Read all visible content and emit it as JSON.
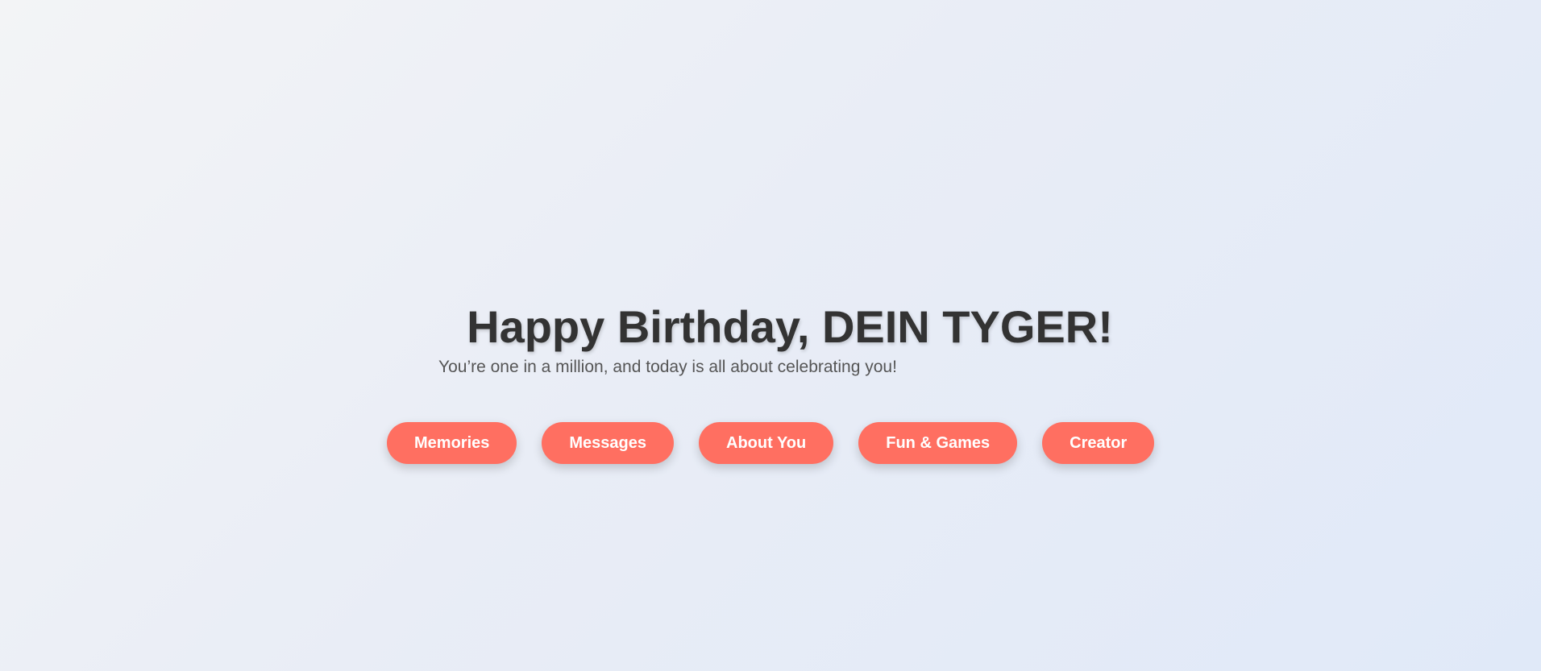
{
  "hero": {
    "title": "Happy Birthday, DEIN TYGER!",
    "subtitle": "You’re one in a million, and today is all about celebrating you!"
  },
  "nav": {
    "items": [
      {
        "label": "Memories"
      },
      {
        "label": "Messages"
      },
      {
        "label": "About You"
      },
      {
        "label": "Fun & Games"
      },
      {
        "label": "Creator"
      }
    ]
  },
  "colors": {
    "accent": "#ff6f61",
    "title_text": "#333333",
    "subtitle_text": "#555555"
  }
}
